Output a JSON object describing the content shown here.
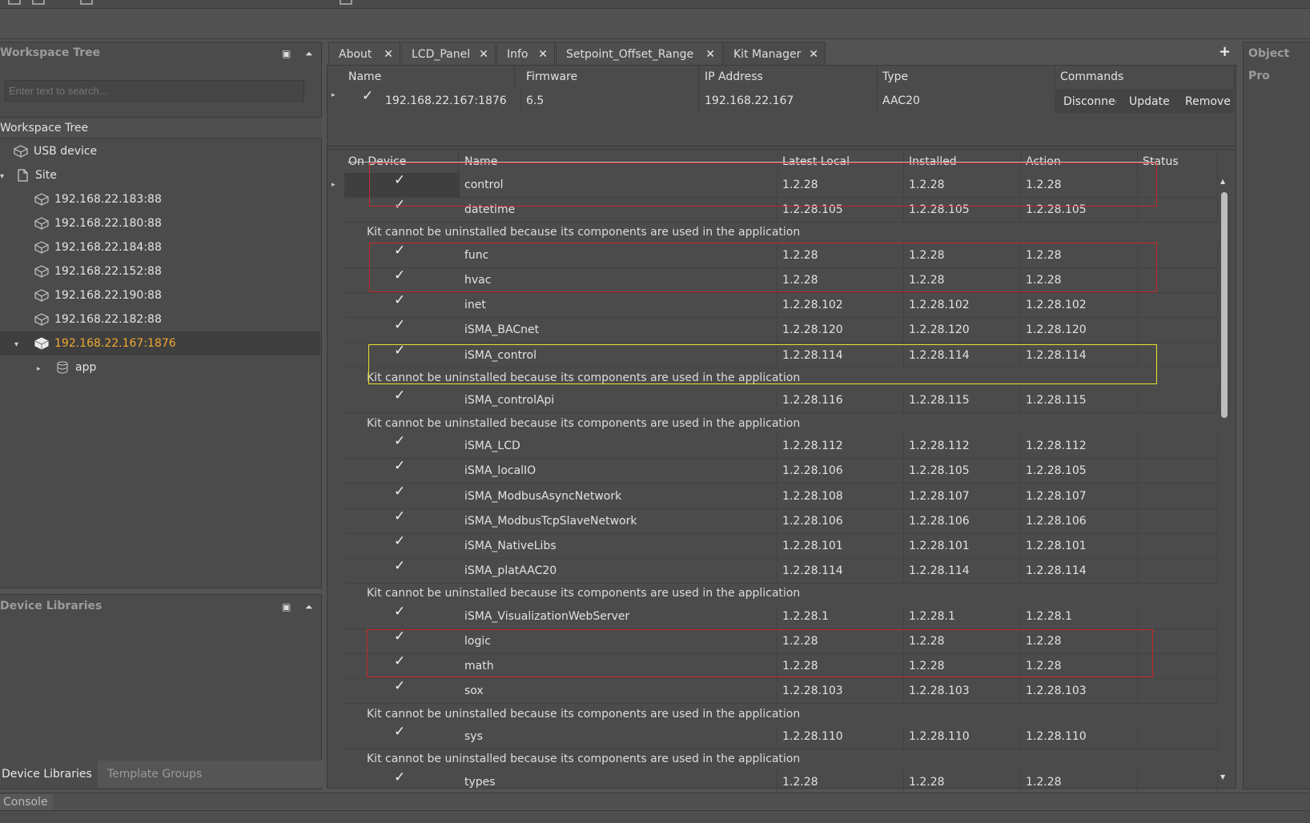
{
  "workspace": {
    "title": "Workspace Tree",
    "search_placeholder": "Enter text to search...",
    "tree_header": "Workspace Tree",
    "items": [
      {
        "label": "USB device"
      },
      {
        "label": "Site"
      },
      {
        "label": "192.168.22.183:88"
      },
      {
        "label": "192.168.22.180:88"
      },
      {
        "label": "192.168.22.184:88"
      },
      {
        "label": "192.168.22.152:88"
      },
      {
        "label": "192.168.22.190:88"
      },
      {
        "label": "192.168.22.182:88"
      },
      {
        "label": "192.168.22.167:1876"
      },
      {
        "label": "app"
      }
    ]
  },
  "device_libraries": {
    "title": "Device Libraries",
    "tabs": [
      "Device Libraries",
      "Template Groups"
    ]
  },
  "tabs": [
    {
      "label": "About"
    },
    {
      "label": "LCD_Panel"
    },
    {
      "label": "Info"
    },
    {
      "label": "Setpoint_Offset_Range"
    },
    {
      "label": "Kit Manager"
    }
  ],
  "add_tab_label": "+",
  "object_panel_title": "Object Pro",
  "device_table": {
    "headers": [
      "Name",
      "Firmware",
      "IP Address",
      "Type",
      "Commands"
    ],
    "row": {
      "name": "192.168.22.167:1876",
      "firmware": "6.5",
      "ip": "192.168.22.167",
      "type": "AAC20",
      "commands": [
        "Disconnect",
        "Update",
        "Remove"
      ]
    }
  },
  "kit_table": {
    "headers": [
      "On Device",
      "Name",
      "Latest Local",
      "Installed",
      "Action",
      "Status"
    ],
    "note": "Kit cannot be uninstalled because its components are used in the application",
    "rows": [
      {
        "name": "control",
        "latest": "1.2.28",
        "installed": "1.2.28",
        "action": "1.2.28"
      },
      {
        "name": "datetime",
        "latest": "1.2.28.105",
        "installed": "1.2.28.105",
        "action": "1.2.28.105"
      },
      {
        "name": "func",
        "latest": "1.2.28",
        "installed": "1.2.28",
        "action": "1.2.28"
      },
      {
        "name": "hvac",
        "latest": "1.2.28",
        "installed": "1.2.28",
        "action": "1.2.28"
      },
      {
        "name": "inet",
        "latest": "1.2.28.102",
        "installed": "1.2.28.102",
        "action": "1.2.28.102"
      },
      {
        "name": "iSMA_BACnet",
        "latest": "1.2.28.120",
        "installed": "1.2.28.120",
        "action": "1.2.28.120"
      },
      {
        "name": "iSMA_control",
        "latest": "1.2.28.114",
        "installed": "1.2.28.114",
        "action": "1.2.28.114"
      },
      {
        "name": "iSMA_controlApi",
        "latest": "1.2.28.116",
        "installed": "1.2.28.115",
        "action": "1.2.28.115"
      },
      {
        "name": "iSMA_LCD",
        "latest": "1.2.28.112",
        "installed": "1.2.28.112",
        "action": "1.2.28.112"
      },
      {
        "name": "iSMA_localIO",
        "latest": "1.2.28.106",
        "installed": "1.2.28.105",
        "action": "1.2.28.105"
      },
      {
        "name": "iSMA_ModbusAsyncNetwork",
        "latest": "1.2.28.108",
        "installed": "1.2.28.107",
        "action": "1.2.28.107"
      },
      {
        "name": "iSMA_ModbusTcpSlaveNetwork",
        "latest": "1.2.28.106",
        "installed": "1.2.28.106",
        "action": "1.2.28.106"
      },
      {
        "name": "iSMA_NativeLibs",
        "latest": "1.2.28.101",
        "installed": "1.2.28.101",
        "action": "1.2.28.101"
      },
      {
        "name": "iSMA_platAAC20",
        "latest": "1.2.28.114",
        "installed": "1.2.28.114",
        "action": "1.2.28.114"
      },
      {
        "name": "iSMA_VisualizationWebServer",
        "latest": "1.2.28.1",
        "installed": "1.2.28.1",
        "action": "1.2.28.1"
      },
      {
        "name": "logic",
        "latest": "1.2.28",
        "installed": "1.2.28",
        "action": "1.2.28"
      },
      {
        "name": "math",
        "latest": "1.2.28",
        "installed": "1.2.28",
        "action": "1.2.28"
      },
      {
        "name": "sox",
        "latest": "1.2.28.103",
        "installed": "1.2.28.103",
        "action": "1.2.28.103"
      },
      {
        "name": "sys",
        "latest": "1.2.28.110",
        "installed": "1.2.28.110",
        "action": "1.2.28.110"
      },
      {
        "name": "types",
        "latest": "1.2.28",
        "installed": "1.2.28",
        "action": "1.2.28"
      }
    ]
  },
  "console_label": "Console",
  "colors": {
    "selected_item": "#f0a830",
    "red_box": "#c8262b",
    "yellow_box": "#e8e030"
  }
}
